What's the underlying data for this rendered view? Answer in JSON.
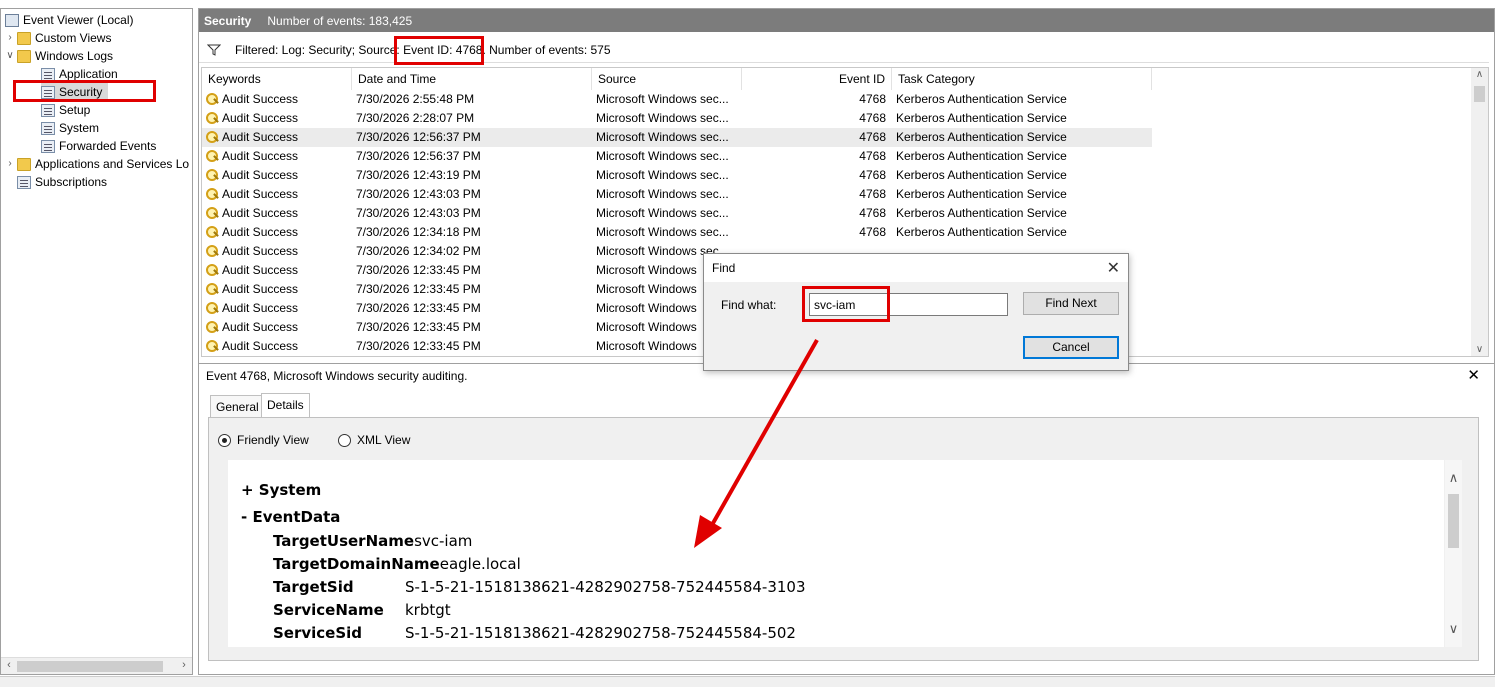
{
  "tree": {
    "root": "Event Viewer (Local)",
    "items": [
      {
        "label": "Custom Views",
        "icon": "folder-icon",
        "expander": ">"
      },
      {
        "label": "Windows Logs",
        "icon": "folder-icon",
        "expander": "v"
      },
      {
        "label": "Application",
        "icon": "log-icon"
      },
      {
        "label": "Security",
        "icon": "log-icon"
      },
      {
        "label": "Setup",
        "icon": "log-icon"
      },
      {
        "label": "System",
        "icon": "log-icon"
      },
      {
        "label": "Forwarded Events",
        "icon": "log-icon"
      },
      {
        "label": "Applications and Services Lo",
        "icon": "folder-icon",
        "expander": ">"
      },
      {
        "label": "Subscriptions",
        "icon": "log-icon"
      }
    ]
  },
  "header": {
    "title": "Security",
    "count": "Number of events: 183,425"
  },
  "filter": {
    "prefix": "Filtered: Log: Security; Source: ",
    "event_id": "Event ID: 4768.",
    "suffix": " Number of events: 575"
  },
  "columns": [
    "Keywords",
    "Date and Time",
    "Source",
    "Event ID",
    "Task Category"
  ],
  "rows": [
    {
      "keywords": "Audit Success",
      "date": "7/30/2026 2:55:48 PM",
      "source": "Microsoft Windows sec...",
      "id": "4768",
      "category": "Kerberos Authentication Service"
    },
    {
      "keywords": "Audit Success",
      "date": "7/30/2026 2:28:07 PM",
      "source": "Microsoft Windows sec...",
      "id": "4768",
      "category": "Kerberos Authentication Service"
    },
    {
      "keywords": "Audit Success",
      "date": "7/30/2026 12:56:37 PM",
      "source": "Microsoft Windows sec...",
      "id": "4768",
      "category": "Kerberos Authentication Service"
    },
    {
      "keywords": "Audit Success",
      "date": "7/30/2026 12:56:37 PM",
      "source": "Microsoft Windows sec...",
      "id": "4768",
      "category": "Kerberos Authentication Service"
    },
    {
      "keywords": "Audit Success",
      "date": "7/30/2026 12:43:19 PM",
      "source": "Microsoft Windows sec...",
      "id": "4768",
      "category": "Kerberos Authentication Service"
    },
    {
      "keywords": "Audit Success",
      "date": "7/30/2026 12:43:03 PM",
      "source": "Microsoft Windows sec...",
      "id": "4768",
      "category": "Kerberos Authentication Service"
    },
    {
      "keywords": "Audit Success",
      "date": "7/30/2026 12:43:03 PM",
      "source": "Microsoft Windows sec...",
      "id": "4768",
      "category": "Kerberos Authentication Service"
    },
    {
      "keywords": "Audit Success",
      "date": "7/30/2026 12:34:18 PM",
      "source": "Microsoft Windows sec...",
      "id": "4768",
      "category": "Kerberos Authentication Service"
    },
    {
      "keywords": "Audit Success",
      "date": "7/30/2026 12:34:02 PM",
      "source": "Microsoft Windows sec...",
      "id": "",
      "category": ""
    },
    {
      "keywords": "Audit Success",
      "date": "7/30/2026 12:33:45 PM",
      "source": "Microsoft Windows",
      "id": "",
      "category": ""
    },
    {
      "keywords": "Audit Success",
      "date": "7/30/2026 12:33:45 PM",
      "source": "Microsoft Windows",
      "id": "",
      "category": ""
    },
    {
      "keywords": "Audit Success",
      "date": "7/30/2026 12:33:45 PM",
      "source": "Microsoft Windows",
      "id": "",
      "category": ""
    },
    {
      "keywords": "Audit Success",
      "date": "7/30/2026 12:33:45 PM",
      "source": "Microsoft Windows",
      "id": "",
      "category": ""
    },
    {
      "keywords": "Audit Success",
      "date": "7/30/2026 12:33:45 PM",
      "source": "Microsoft Windows",
      "id": "",
      "category": ""
    }
  ],
  "details": {
    "title": "Event 4768, Microsoft Windows security auditing.",
    "tabs": [
      "General",
      "Details"
    ],
    "views": [
      "Friendly View",
      "XML View"
    ],
    "system": "+ System",
    "eventdata": "- EventData",
    "fields": [
      {
        "k": "TargetUserName",
        "v": "svc-iam"
      },
      {
        "k": "TargetDomainName",
        "v": "eagle.local"
      },
      {
        "k": "TargetSid",
        "v": "S-1-5-21-1518138621-4282902758-752445584-3103"
      },
      {
        "k": "ServiceName",
        "v": "krbtgt"
      },
      {
        "k": "ServiceSid",
        "v": "S-1-5-21-1518138621-4282902758-752445584-502"
      }
    ]
  },
  "find": {
    "title": "Find",
    "label": "Find what:",
    "value": "svc-iam",
    "find_next": "Find Next",
    "cancel": "Cancel"
  },
  "annotation_color": "#e00000"
}
